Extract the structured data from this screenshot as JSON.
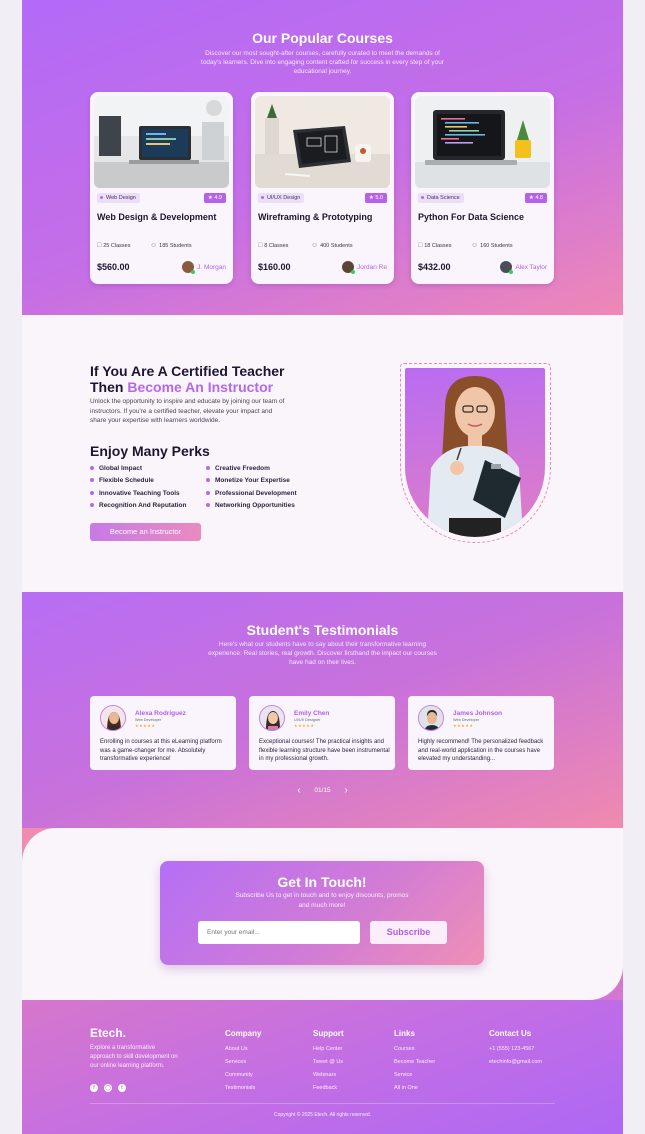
{
  "courses_section": {
    "title": "Our Popular Courses",
    "subtitle": "Discover our most sought-after courses, carefully curated to meet the demands of today's learners. Dive into engaging content crafted for success in every step of your educational journey.",
    "cards": [
      {
        "category": "Web Design",
        "rating": "★ 4.9",
        "title": "Web Design & Development",
        "classes": "25 Classes",
        "students": "185 Students",
        "price": "$560.00",
        "author": "J. Morgan"
      },
      {
        "category": "UI/UX Design",
        "rating": "★ 5.0",
        "title": "Wireframing & Prototyping",
        "classes": "8 Classes",
        "students": "400 Students",
        "price": "$160.00",
        "author": "Jordan Re"
      },
      {
        "category": "Data Science",
        "rating": "★ 4.8",
        "title": "Python For Data Science",
        "classes": "18 Classes",
        "students": "160 Students",
        "price": "$432.00",
        "author": "Alex Taylor"
      }
    ]
  },
  "instructor_section": {
    "heading_line1": "If You Are A Certified Teacher",
    "heading_then": "Then",
    "heading_highlight": "Become An Instructor",
    "description": "Unlock the opportunity to inspire and educate by joining our team of instructors. If you're a certified teacher, elevate your impact and share your expertise with learners worldwide.",
    "perks_title": "Enjoy Many Perks",
    "perks_left": [
      "Global Impact",
      "Flexible Schedule",
      "Innovative Teaching Tools",
      "Recognition And Reputation"
    ],
    "perks_right": [
      "Creative Freedom",
      "Monetize Your Expertise",
      "Professional Development",
      "Networking Opportunities"
    ],
    "cta": "Become an Instructor"
  },
  "testimonials_section": {
    "title": "Student's Testimonials",
    "subtitle": "Here's what our students have to say about their transformative learning experience: Real stories, real growth. Discover firsthand the impact our courses have had on their lives.",
    "items": [
      {
        "name": "Alexa Rodriguez",
        "role": "Web Developer",
        "stars": "★★★★★",
        "text": "Enrolling in courses at this eLearning platform was a game-changer for me. Absolutely transformative experience!"
      },
      {
        "name": "Emily Chen",
        "role": "UI/UX Designer",
        "stars": "★★★★★",
        "text": "Exceptional courses! The practical insights and flexible learning structure have been instrumental in my professional growth."
      },
      {
        "name": "James Johnson",
        "role": "Web Developer",
        "stars": "★★★★★",
        "text": "Highly recommend! The personalized feedback and real-world application in the courses have elevated my understanding..."
      }
    ],
    "pager": "01/15"
  },
  "contact_section": {
    "title": "Get In Touch!",
    "subtitle": "Subscribe Us to get in touch and to enjoy discounts, promos and much more!",
    "email_placeholder": "Enter your email...",
    "subscribe_label": "Subscribe"
  },
  "footer": {
    "brand": "Etech.",
    "brand_text": "Explore a transformative approach to skill development on our online learning platform.",
    "columns": [
      {
        "title": "Company",
        "links": [
          "About Us",
          "Services",
          "Community",
          "Testimonials"
        ]
      },
      {
        "title": "Support",
        "links": [
          "Help Center",
          "Tweet @ Us",
          "Webinars",
          "Feedback"
        ]
      },
      {
        "title": "Links",
        "links": [
          "Courses",
          "Become Teacher",
          "Service",
          "All in One"
        ]
      },
      {
        "title": "Contact Us",
        "links": [
          "+1 (555) 123-4567",
          "etechinfo@gmail.com"
        ]
      }
    ],
    "copyright": "Copyright © 2025 Etech. All rights reserved."
  }
}
